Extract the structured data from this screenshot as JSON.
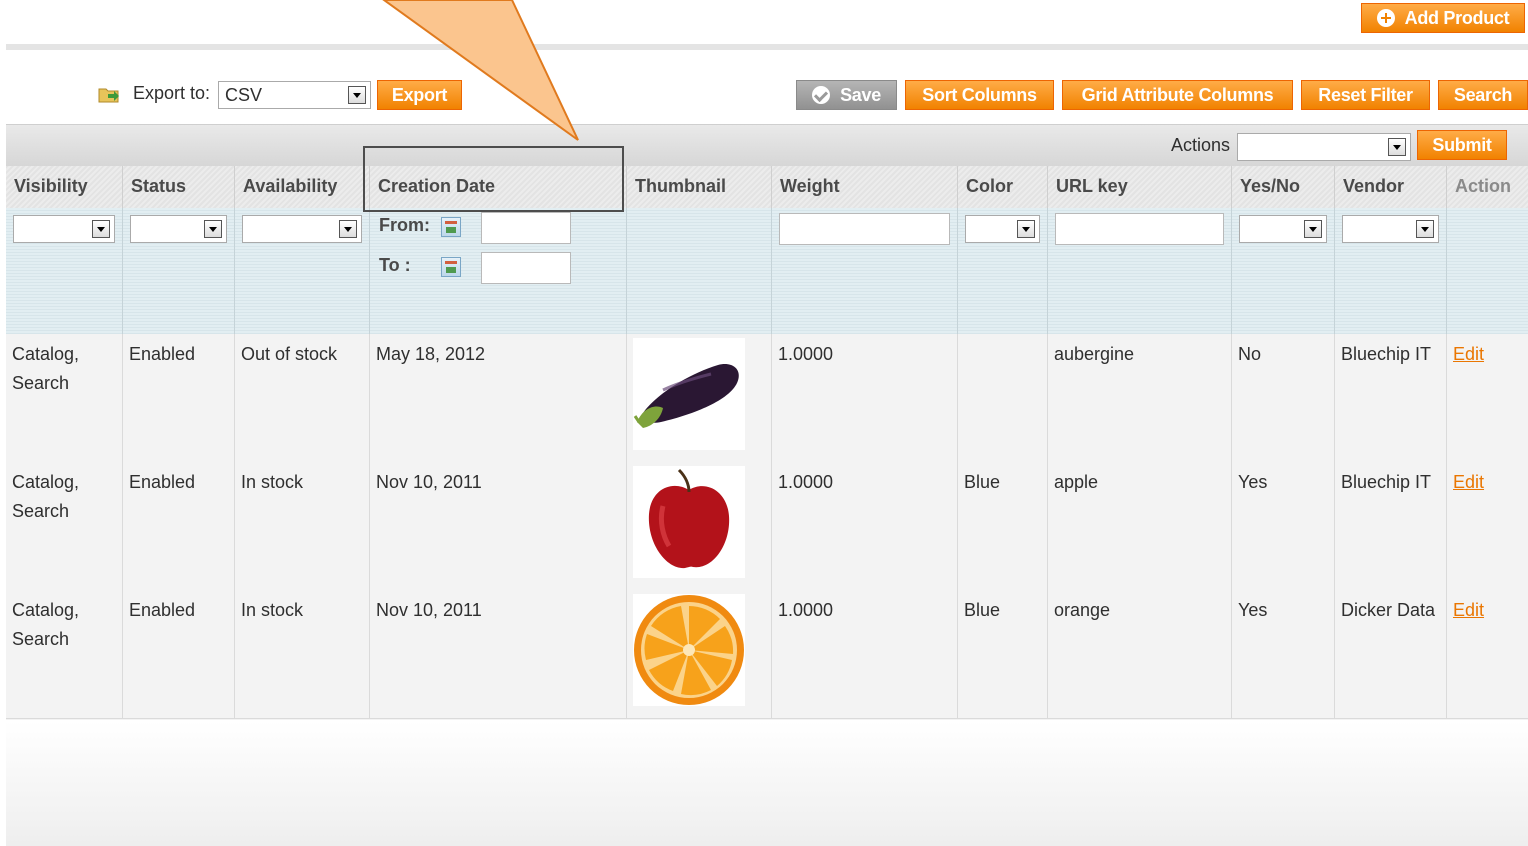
{
  "header": {
    "add_product_label": "Add Product"
  },
  "toolbar": {
    "export_label": "Export to:",
    "export_format": "CSV",
    "export_button": "Export",
    "save_button": "Save",
    "sort_columns_button": "Sort Columns",
    "grid_attribute_columns_button": "Grid Attribute Columns",
    "reset_filter_button": "Reset Filter",
    "search_button": "Search"
  },
  "massaction": {
    "label": "Actions",
    "selected": "",
    "submit_button": "Submit"
  },
  "columns": [
    "Visibility",
    "Status",
    "Availability",
    "Creation Date",
    "Thumbnail",
    "Weight",
    "Color",
    "URL key",
    "Yes/No",
    "Vendor",
    "Action"
  ],
  "filters": {
    "from_label": "From:",
    "to_label": "To :"
  },
  "rows": [
    {
      "visibility": "Catalog, Search",
      "status": "Enabled",
      "availability": "Out of stock",
      "creation_date": "May 18, 2012",
      "thumbnail": "eggplant-image",
      "weight": "1.0000",
      "color": "",
      "url_key": "aubergine",
      "yes_no": "No",
      "vendor": "Bluechip IT",
      "action": "Edit"
    },
    {
      "visibility": "Catalog, Search",
      "status": "Enabled",
      "availability": "In stock",
      "creation_date": "Nov 10, 2011",
      "thumbnail": "apple-image",
      "weight": "1.0000",
      "color": "Blue",
      "url_key": "apple",
      "yes_no": "Yes",
      "vendor": "Bluechip IT",
      "action": "Edit"
    },
    {
      "visibility": "Catalog, Search",
      "status": "Enabled",
      "availability": "In stock",
      "creation_date": "Nov 10, 2011",
      "thumbnail": "orange-image",
      "weight": "1.0000",
      "color": "Blue",
      "url_key": "orange",
      "yes_no": "Yes",
      "vendor": "Dicker Data",
      "action": "Edit"
    }
  ],
  "colors": {
    "accent": "#f18200",
    "link": "#ea7601",
    "callout": "#fbc58e"
  }
}
